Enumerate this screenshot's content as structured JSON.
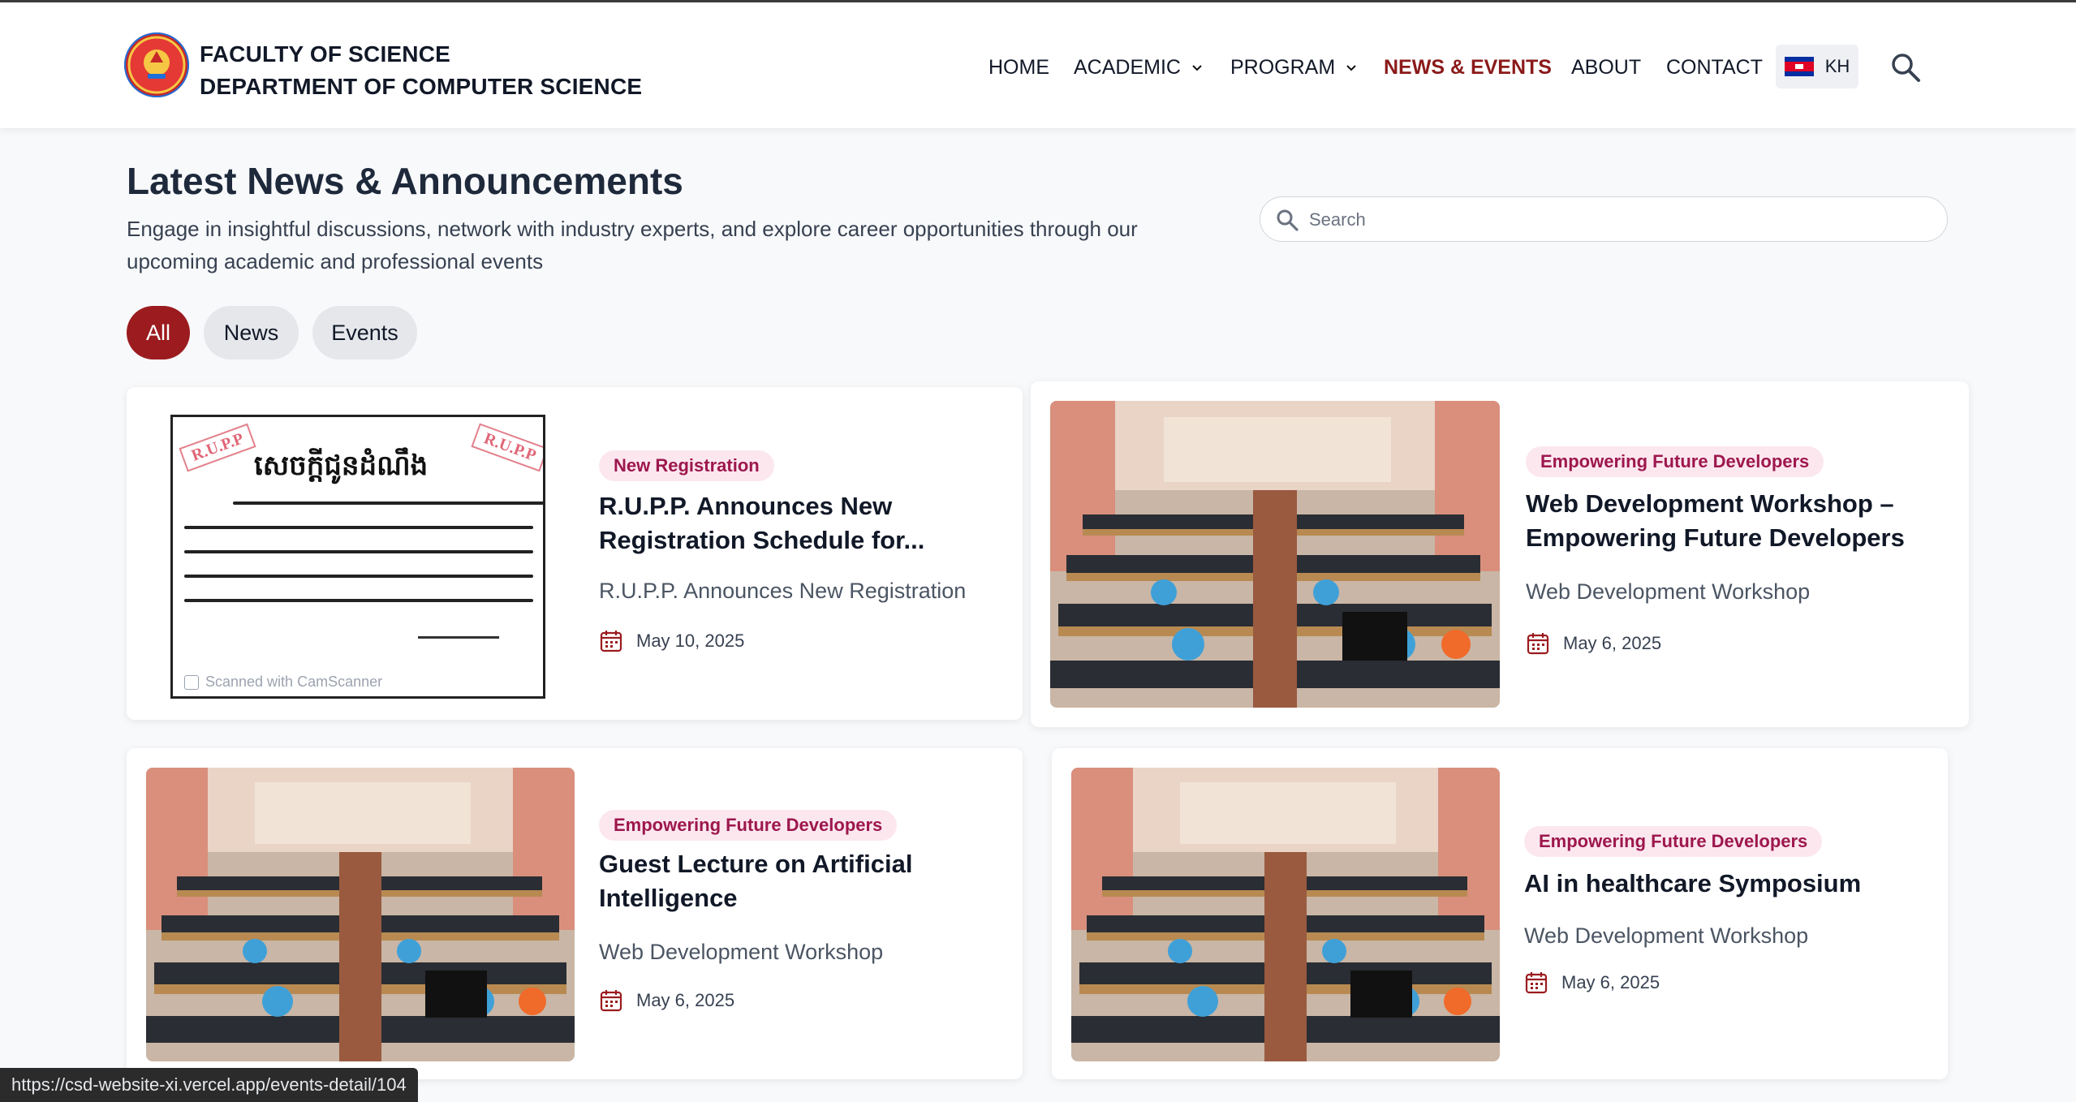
{
  "header": {
    "brand_line1": "FACULTY OF SCIENCE",
    "brand_line2": "DEPARTMENT OF COMPUTER SCIENCE",
    "nav": [
      {
        "label": "HOME"
      },
      {
        "label": "ACADEMIC"
      },
      {
        "label": "PROGRAM"
      },
      {
        "label": "NEWS & EVENTS",
        "active": true
      },
      {
        "label": "ABOUT"
      },
      {
        "label": "CONTACT"
      }
    ],
    "lang_label": "KH",
    "icons": {
      "logo": "faculty-emblem",
      "lang": "cambodia-flag",
      "search": "search-icon"
    }
  },
  "page": {
    "title": "Latest News & Announcements",
    "subtitle": "Engage in insightful discussions, network with industry experts, and explore career opportunities through our upcoming academic and professional events",
    "search_placeholder": "Search"
  },
  "filters": [
    {
      "label": "All",
      "active": true
    },
    {
      "label": "News"
    },
    {
      "label": "Events"
    }
  ],
  "cards": [
    {
      "tag": "New Registration",
      "title": "R.U.P.P. Announces New Registration Schedule for...",
      "description": "R.U.P.P. Announces New Registration",
      "date": "May 10, 2025",
      "image": {
        "stamp": "R.U.P.P",
        "heading": "សេចក្តីជូនដំណឹង",
        "watermark": "Scanned with CamScanner"
      }
    },
    {
      "tag": "Empowering Future Developers",
      "title": "Web Development Workshop – Empowering Future Developers",
      "description": "Web Development Workshop",
      "date": "May 6, 2025"
    },
    {
      "tag": "Empowering Future Developers",
      "title": "Guest Lecture on Artificial Intelligence",
      "description": "Web Development Workshop",
      "date": "May 6, 2025"
    },
    {
      "tag": "Empowering Future Developers",
      "title": "AI in healthcare Symposium",
      "description": "Web Development Workshop",
      "date": "May 6, 2025"
    }
  ],
  "status_bar": {
    "url": "https://csd-website-xi.vercel.app/events-detail/104"
  },
  "colors": {
    "accent": "#8b1a1a",
    "filter_active": "#9b1b1e",
    "tag_bg": "#fce7ef",
    "tag_text": "#9d174d"
  }
}
